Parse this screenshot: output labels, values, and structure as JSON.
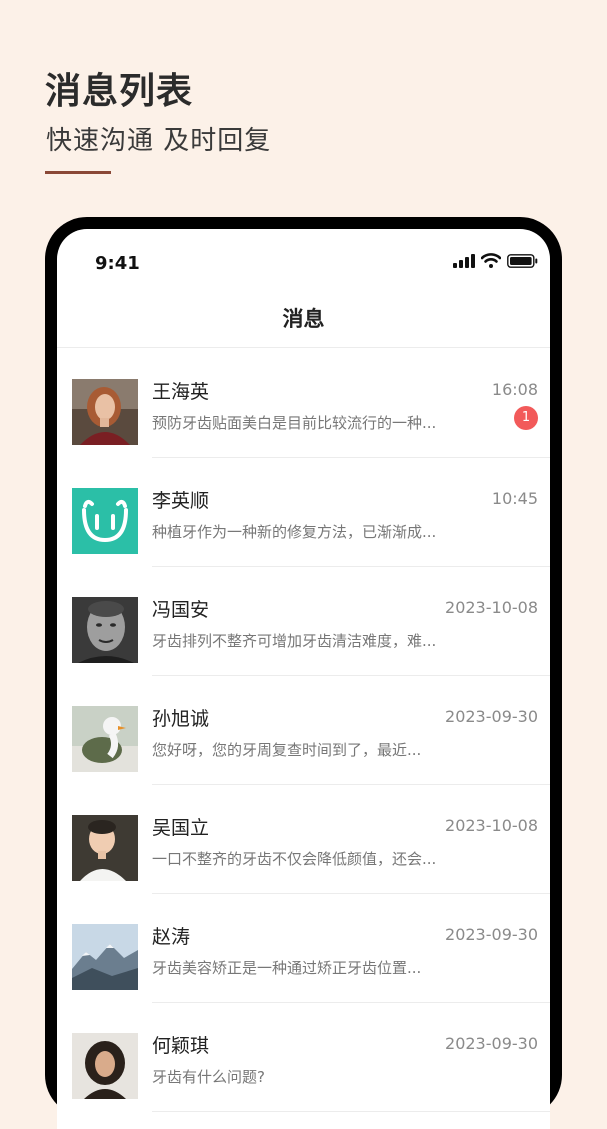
{
  "hero": {
    "title": "消息列表",
    "subtitle": "快速沟通 及时回复"
  },
  "status_bar": {
    "time": "9:41",
    "icons": [
      "signal-icon",
      "wifi-icon",
      "battery-icon"
    ]
  },
  "nav": {
    "title": "消息"
  },
  "colors": {
    "background": "#fcf1e8",
    "accent_underline": "#8a4836",
    "badge": "#f25a5a",
    "logo_teal": "#2bbfa7"
  },
  "messages": [
    {
      "name": "王海英",
      "time": "16:08",
      "preview": "预防牙齿贴面美白是目前比较流行的一种...",
      "badge": "1"
    },
    {
      "name": "李英顺",
      "time": "10:45",
      "preview": "种植牙作为一种新的修复方法，已渐渐成..."
    },
    {
      "name": "冯国安",
      "time": "2023-10-08",
      "preview": "牙齿排列不整齐可增加牙齿清洁难度，难..."
    },
    {
      "name": "孙旭诚",
      "time": "2023-09-30",
      "preview": "您好呀，您的牙周复查时间到了，最近..."
    },
    {
      "name": "吴国立",
      "time": "2023-10-08",
      "preview": "一口不整齐的牙齿不仅会降低颜值，还会..."
    },
    {
      "name": "赵涛",
      "time": "2023-09-30",
      "preview": "牙齿美容矫正是一种通过矫正牙齿位置..."
    },
    {
      "name": "何颖琪",
      "time": "2023-09-30",
      "preview": "牙齿有什么问题?"
    }
  ]
}
